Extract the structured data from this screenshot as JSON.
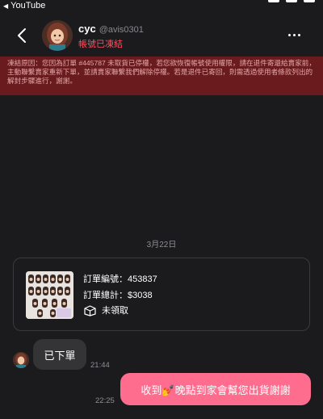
{
  "status_bar": {
    "back_app": "YouTube"
  },
  "header": {
    "name": "cyc",
    "handle": "@avis0301",
    "status": "帳號已凍結"
  },
  "banner": {
    "text": "凍結原因：您因為訂單 #445787 未取貨已停權，若您欲恢復帳號使用權限，請在退件寄還給賣家前，主動聯繫賣家重新下單，並請賣家聯繫我們解除停權。若是退件已寄回，則需透過使用者條款列出的解封步驟進行，謝謝。"
  },
  "chat": {
    "date": "3月22日",
    "order": {
      "number": "訂單編號：453837",
      "total": "訂單總計：$3038",
      "status": "未領取"
    },
    "messages": [
      {
        "text": "已下單",
        "time": "21:44"
      },
      {
        "text": "收到💅晚點到家會幫您出貨謝謝",
        "time": "22:25"
      }
    ]
  },
  "colors": {
    "background": "#1b1b1d",
    "banner_bg": "#6a1b1e",
    "frozen_text": "#ff4d5e",
    "outgoing_bubble": "#fe6c8e",
    "incoming_bubble": "#343437"
  }
}
